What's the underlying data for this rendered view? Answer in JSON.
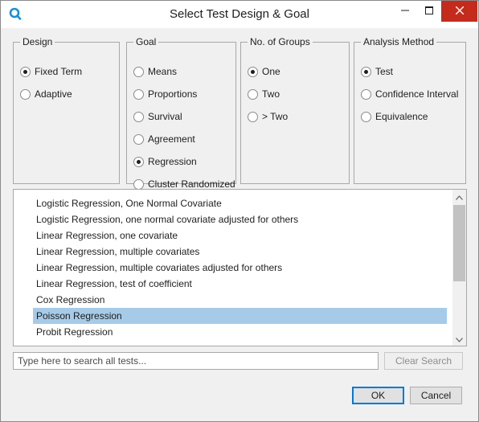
{
  "window": {
    "title": "Select Test Design & Goal",
    "close_color": "#c42b1c",
    "accent": "#0078d7",
    "selection_color": "#a6cbe8"
  },
  "groups": {
    "design": {
      "legend": "Design",
      "options": [
        {
          "label": "Fixed Term",
          "checked": true
        },
        {
          "label": "Adaptive",
          "checked": false
        }
      ]
    },
    "goal": {
      "legend": "Goal",
      "options": [
        {
          "label": "Means",
          "checked": false
        },
        {
          "label": "Proportions",
          "checked": false
        },
        {
          "label": "Survival",
          "checked": false
        },
        {
          "label": "Agreement",
          "checked": false
        },
        {
          "label": "Regression",
          "checked": true
        },
        {
          "label": "Cluster Randomized",
          "checked": false
        }
      ]
    },
    "groups_count": {
      "legend": "No. of Groups",
      "options": [
        {
          "label": "One",
          "checked": true
        },
        {
          "label": "Two",
          "checked": false
        },
        {
          "label": "> Two",
          "checked": false
        }
      ]
    },
    "analysis": {
      "legend": "Analysis Method",
      "options": [
        {
          "label": "Test",
          "checked": true
        },
        {
          "label": "Confidence Interval",
          "checked": false
        },
        {
          "label": "Equivalence",
          "checked": false
        }
      ]
    }
  },
  "tests_list": {
    "items": [
      "Logistic Regression, One Normal Covariate",
      "Logistic Regression, one normal covariate adjusted for others",
      "Linear Regression, one covariate",
      "Linear Regression, multiple covariates",
      "Linear Regression, multiple covariates adjusted for others",
      "Linear Regression, test of coefficient",
      "Cox Regression",
      "Poisson Regression",
      "Probit Regression"
    ],
    "selected_item": "Poisson Regression"
  },
  "search": {
    "placeholder": "Type here to search all tests...",
    "value": "",
    "clear_label": "Clear Search"
  },
  "footer": {
    "ok_label": "OK",
    "cancel_label": "Cancel"
  },
  "icons": {
    "app": "search-logo-icon",
    "minimize": "minimize-icon",
    "maximize": "maximize-icon",
    "close": "close-icon",
    "scroll_up": "chevron-up-icon",
    "scroll_down": "chevron-down-icon"
  }
}
